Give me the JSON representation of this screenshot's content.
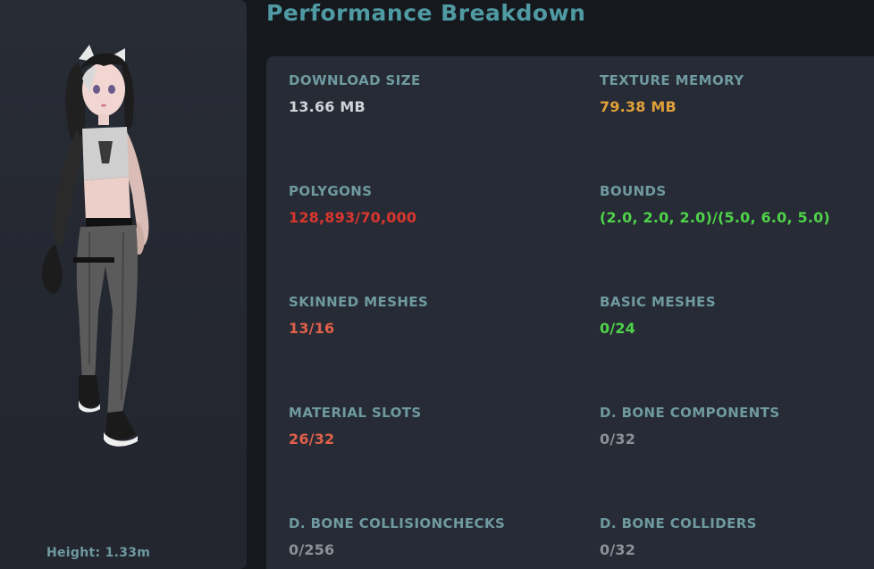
{
  "avatar": {
    "height_label": "Height: 1.33m"
  },
  "header": {
    "title": "Performance Breakdown"
  },
  "stats": [
    {
      "label": "DOWNLOAD SIZE",
      "value": "13.66 MB",
      "color": "#cfd3d8"
    },
    {
      "label": "TEXTURE MEMORY",
      "value": "79.38 MB",
      "color": "#e0a03a"
    },
    {
      "label": "POLYGONS",
      "value": "128,893/70,000",
      "color": "#d9362e"
    },
    {
      "label": "BOUNDS",
      "value": "(2.0, 2.0, 2.0)/(5.0, 6.0, 5.0)",
      "color": "#4fd34a"
    },
    {
      "label": "SKINNED MESHES",
      "value": "13/16",
      "color": "#e0604a"
    },
    {
      "label": "BASIC MESHES",
      "value": "0/24",
      "color": "#4fd34a"
    },
    {
      "label": "MATERIAL SLOTS",
      "value": "26/32",
      "color": "#e0604a"
    },
    {
      "label": "D. BONE COMPONENTS",
      "value": "0/32",
      "color": "#8d9197"
    },
    {
      "label": "D. BONE COLLISIONCHECKS",
      "value": "0/256",
      "color": "#8d9197"
    },
    {
      "label": "D. BONE COLLIDERS",
      "value": "0/32",
      "color": "#8d9197"
    }
  ]
}
